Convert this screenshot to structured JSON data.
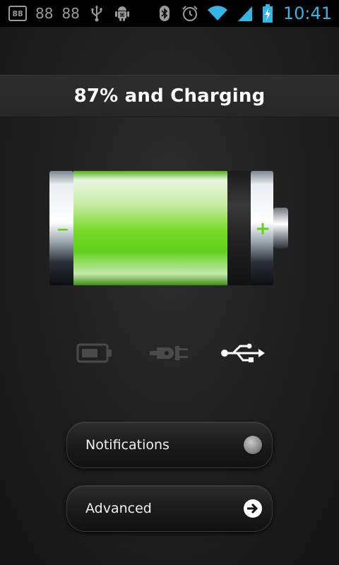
{
  "status_bar": {
    "left_box_text": "88",
    "num1": "88",
    "num2": "88",
    "time": "10:41",
    "icons": [
      "usb-debug-icon",
      "android-icon",
      "bluetooth-icon",
      "alarm-icon",
      "wifi-icon",
      "signal-icon",
      "battery-charging-icon"
    ]
  },
  "header": {
    "title": "87% and Charging"
  },
  "battery": {
    "level": 0.87,
    "fill_color": "#5fd21a",
    "minus_label": "−",
    "plus_label": "+"
  },
  "sources": [
    "battery-source-icon",
    "ac-plug-icon",
    "usb-icon"
  ],
  "active_source": "usb",
  "menu": {
    "notifications_label": "Notifications",
    "advanced_label": "Advanced"
  },
  "colors": {
    "time_blue": "#33b5e5",
    "accent_green": "#5fd21a"
  }
}
